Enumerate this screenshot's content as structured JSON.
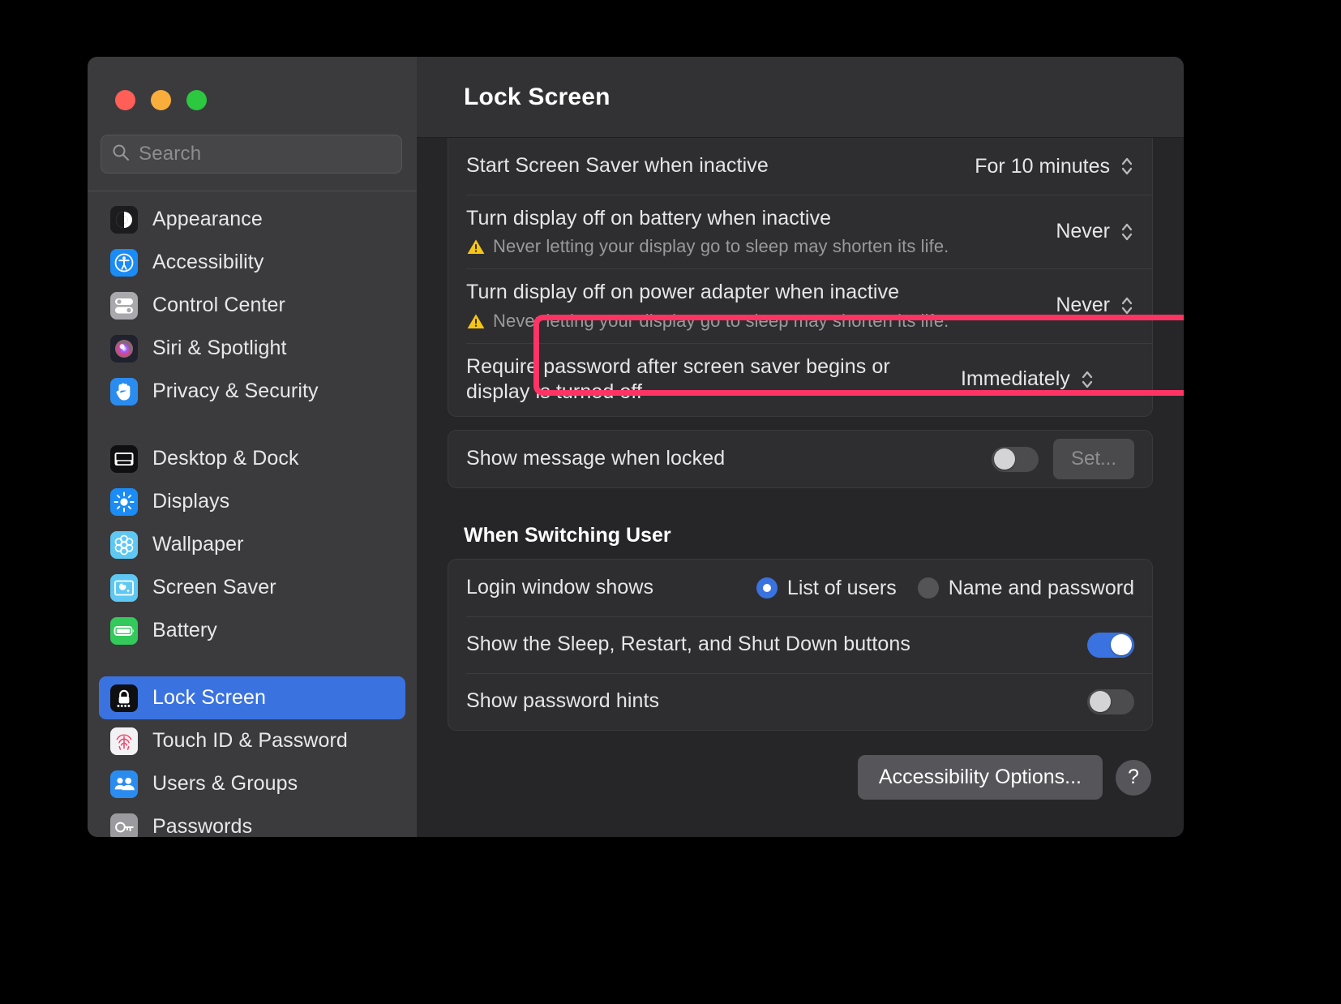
{
  "window": {
    "title": "Lock Screen",
    "traffic_lights": [
      "close",
      "minimize",
      "zoom"
    ]
  },
  "search": {
    "placeholder": "Search",
    "icon": "search-icon"
  },
  "sidebar": {
    "groups": [
      {
        "items": [
          {
            "label": "Appearance",
            "icon": "appearance-icon",
            "selected": false
          },
          {
            "label": "Accessibility",
            "icon": "accessibility-icon",
            "selected": false
          },
          {
            "label": "Control Center",
            "icon": "control-center-icon",
            "selected": false
          },
          {
            "label": "Siri & Spotlight",
            "icon": "siri-icon",
            "selected": false
          },
          {
            "label": "Privacy & Security",
            "icon": "privacy-icon",
            "selected": false
          }
        ]
      },
      {
        "items": [
          {
            "label": "Desktop & Dock",
            "icon": "desktop-dock-icon",
            "selected": false
          },
          {
            "label": "Displays",
            "icon": "displays-icon",
            "selected": false
          },
          {
            "label": "Wallpaper",
            "icon": "wallpaper-icon",
            "selected": false
          },
          {
            "label": "Screen Saver",
            "icon": "screen-saver-icon",
            "selected": false
          },
          {
            "label": "Battery",
            "icon": "battery-icon",
            "selected": false
          }
        ]
      },
      {
        "items": [
          {
            "label": "Lock Screen",
            "icon": "lock-screen-icon",
            "selected": true
          },
          {
            "label": "Touch ID & Password",
            "icon": "touch-id-icon",
            "selected": false
          },
          {
            "label": "Users & Groups",
            "icon": "users-groups-icon",
            "selected": false
          },
          {
            "label": "Passwords",
            "icon": "passwords-icon",
            "selected": false
          }
        ]
      }
    ],
    "selected_accent": "#3a72e0"
  },
  "main": {
    "rows": {
      "start_screen_saver": {
        "label": "Start Screen Saver when inactive",
        "value": "For 10 minutes"
      },
      "display_off_battery": {
        "label": "Turn display off on battery when inactive",
        "value": "Never",
        "warning": "Never letting your display go to sleep may shorten its life."
      },
      "display_off_power": {
        "label": "Turn display off on power adapter when inactive",
        "value": "Never",
        "warning": "Never letting your display go to sleep may shorten its life."
      },
      "require_password": {
        "label": "Require password after screen saver begins or display is turned off",
        "value": "Immediately"
      },
      "show_message": {
        "label": "Show message when locked",
        "toggle": "off",
        "button": "Set..."
      }
    },
    "switching_user": {
      "heading": "When Switching User",
      "login_window": {
        "label": "Login window shows",
        "options": [
          {
            "label": "List of users",
            "selected": true
          },
          {
            "label": "Name and password",
            "selected": false
          }
        ]
      },
      "sleep_restart_shutdown": {
        "label": "Show the Sleep, Restart, and Shut Down buttons",
        "toggle": "on"
      },
      "password_hints": {
        "label": "Show password hints",
        "toggle": "off"
      }
    },
    "footer": {
      "accessibility_button": "Accessibility Options...",
      "help_button": "?"
    }
  },
  "annotation": {
    "target": "display_off_power",
    "color": "#ff3465"
  }
}
